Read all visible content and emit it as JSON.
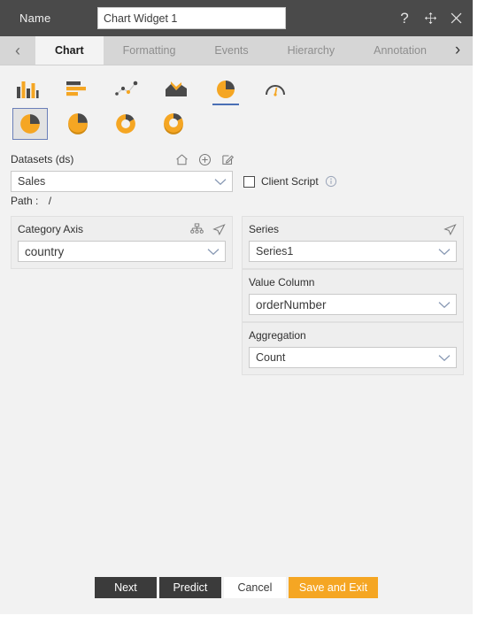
{
  "titlebar": {
    "name_label": "Name",
    "name_value": "Chart Widget 1",
    "name_placeholder": "Chart Widget 1",
    "help_icon": "question-mark-icon",
    "move_icon": "move-icon",
    "close_icon": "close-icon"
  },
  "tabs": {
    "prev_arrow": "‹",
    "next_arrow": "›",
    "items": [
      {
        "label": "Chart",
        "active": true
      },
      {
        "label": "Formatting",
        "active": false
      },
      {
        "label": "Events",
        "active": false
      },
      {
        "label": "Hierarchy",
        "active": false
      },
      {
        "label": "Annotation",
        "active": false
      }
    ]
  },
  "chart_types": {
    "row1": [
      {
        "name": "column-chart-icon",
        "selected": false
      },
      {
        "name": "bar-chart-icon",
        "selected": false
      },
      {
        "name": "scatter-chart-icon",
        "selected": false
      },
      {
        "name": "area-chart-icon",
        "selected": false
      },
      {
        "name": "pie-chart-icon",
        "selected": true
      },
      {
        "name": "gauge-chart-icon",
        "selected": false
      }
    ],
    "row2": [
      {
        "name": "pie-flat-icon",
        "selected": true
      },
      {
        "name": "pie-3d-icon",
        "selected": false
      },
      {
        "name": "donut-flat-icon",
        "selected": false
      },
      {
        "name": "donut-3d-icon",
        "selected": false
      }
    ]
  },
  "datasets": {
    "title": "Datasets (ds)",
    "home_icon": "home-icon",
    "add_icon": "plus-circle-icon",
    "edit_icon": "edit-icon",
    "selected": "Sales",
    "client_script_label": "Client Script",
    "client_script_checked": false,
    "info_icon": "info-icon",
    "path_label": "Path :",
    "path_value": "/"
  },
  "category_axis": {
    "label": "Category Axis",
    "hierarchy_icon": "hierarchy-icon",
    "send_icon": "paper-plane-icon",
    "value": "country"
  },
  "series": {
    "label": "Series",
    "send_icon": "paper-plane-icon",
    "value": "Series1",
    "value_column_label": "Value Column",
    "value_column": "orderNumber",
    "aggregation_label": "Aggregation",
    "aggregation": "Count"
  },
  "footer": {
    "next": "Next",
    "predict": "Predict",
    "cancel": "Cancel",
    "save_and_exit": "Save and Exit"
  },
  "colors": {
    "accent": "#f5a623",
    "dark_gray": "#4a4a4a",
    "selection_blue": "#4a6fb5"
  }
}
